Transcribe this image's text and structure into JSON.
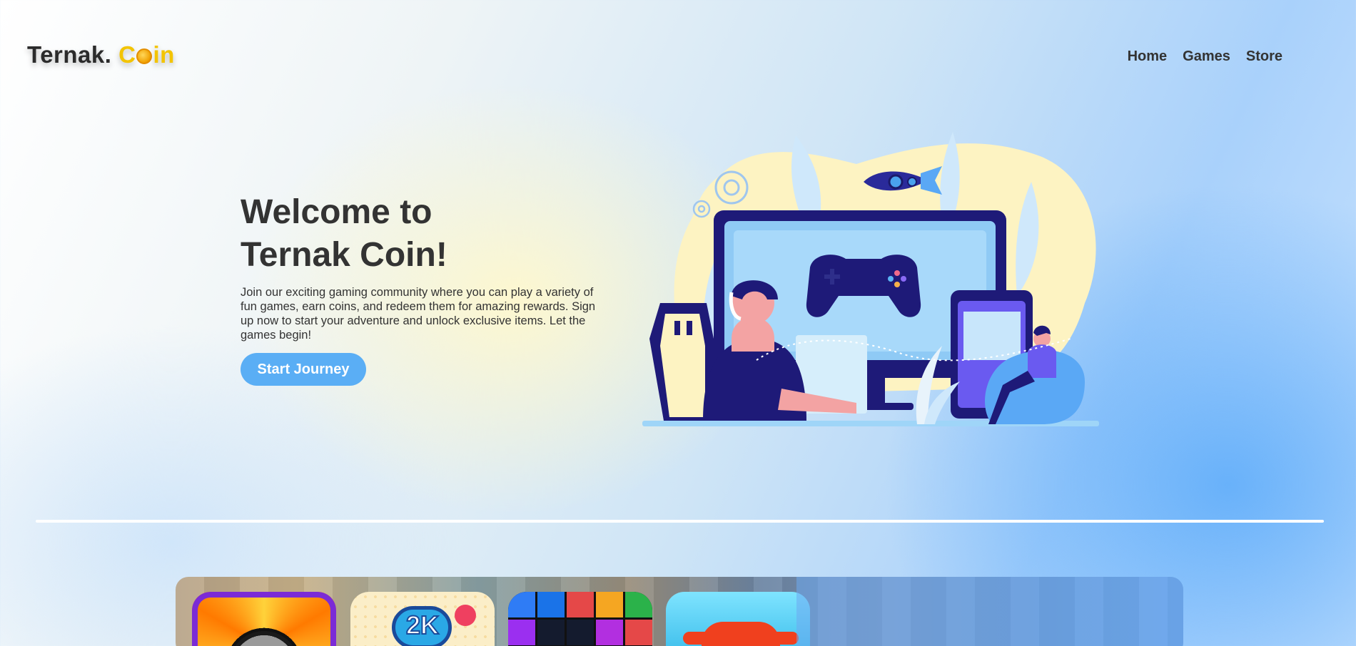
{
  "logo": {
    "prefix": "Ternak.",
    "suffix_c": "C",
    "suffix_rest": "in"
  },
  "nav": {
    "home": "Home",
    "games": "Games",
    "store": "Store"
  },
  "hero": {
    "title_line1": "Welcome to",
    "title_line2": "Ternak Coin!",
    "description": "Join our exciting gaming community where you can play a variety of fun games, earn coins, and redeem them for amazing rewards. Sign up now to start your adventure and unlock exclusive items. Let the games begin!",
    "cta": "Start Journey"
  },
  "games_strip": {
    "thumbnails": [
      {
        "name": "bomb-game",
        "text": ""
      },
      {
        "name": "2k-merge-game",
        "text": "2K"
      },
      {
        "name": "block-breaker-game",
        "text": ""
      },
      {
        "name": "stickman-runner-game",
        "text": ""
      }
    ]
  },
  "colors": {
    "accent": "#5aaef5",
    "text_dark": "#333333",
    "coin_yellow": "#f3c400",
    "illustration_navy": "#1e1a78",
    "illustration_blue": "#9fd5f8"
  }
}
